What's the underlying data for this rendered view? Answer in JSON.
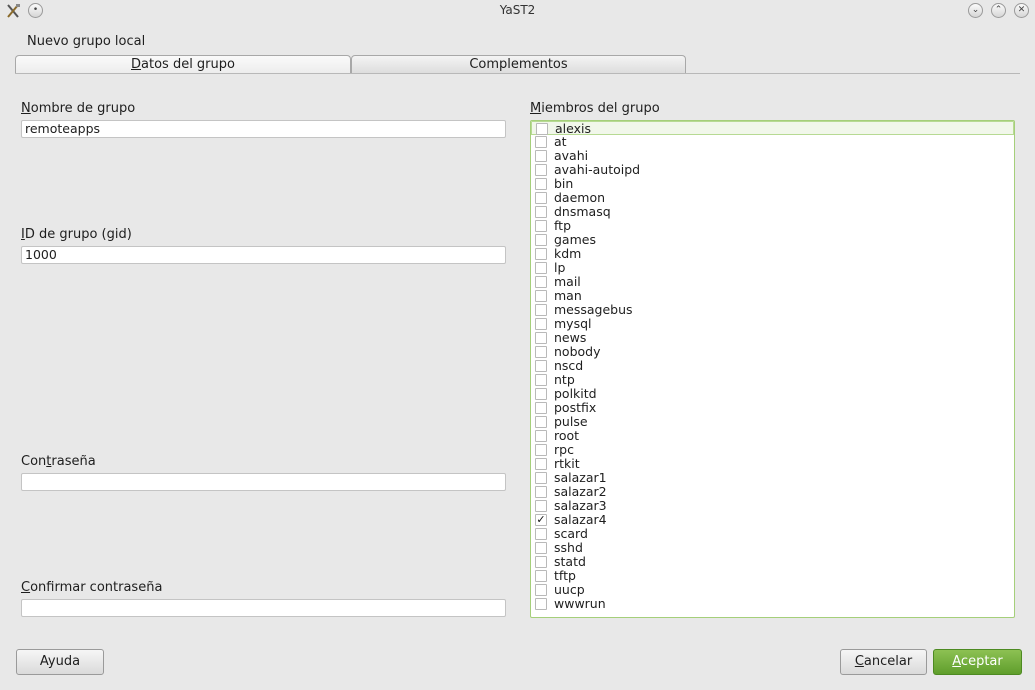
{
  "window": {
    "title": "YaST2",
    "controls": [
      "minimize-icon",
      "maximize-icon",
      "close-icon"
    ]
  },
  "dialog": {
    "heading": "Nuevo grupo local"
  },
  "tabs": [
    {
      "label_first": "D",
      "label_rest": "atos del grupo",
      "active": true
    },
    {
      "label": "Complementos",
      "active": false
    }
  ],
  "form": {
    "group_name": {
      "label_first": "N",
      "label_rest": "ombre de grupo",
      "value": "remoteapps"
    },
    "group_id": {
      "label_first": "I",
      "label_rest": "D de grupo (gid)",
      "value": "1000"
    },
    "password": {
      "label_pre": "Con",
      "label_ul": "t",
      "label_rest": "raseña",
      "value": ""
    },
    "confirm_password": {
      "label_first": "C",
      "label_rest": "onfirmar contraseña",
      "value": ""
    }
  },
  "members": {
    "label_first": "M",
    "label_rest": "iembros del grupo",
    "items": [
      {
        "name": "alexis",
        "checked": false
      },
      {
        "name": "at",
        "checked": false
      },
      {
        "name": "avahi",
        "checked": false
      },
      {
        "name": "avahi-autoipd",
        "checked": false
      },
      {
        "name": "bin",
        "checked": false
      },
      {
        "name": "daemon",
        "checked": false
      },
      {
        "name": "dnsmasq",
        "checked": false
      },
      {
        "name": "ftp",
        "checked": false
      },
      {
        "name": "games",
        "checked": false
      },
      {
        "name": "kdm",
        "checked": false
      },
      {
        "name": "lp",
        "checked": false
      },
      {
        "name": "mail",
        "checked": false
      },
      {
        "name": "man",
        "checked": false
      },
      {
        "name": "messagebus",
        "checked": false
      },
      {
        "name": "mysql",
        "checked": false
      },
      {
        "name": "news",
        "checked": false
      },
      {
        "name": "nobody",
        "checked": false
      },
      {
        "name": "nscd",
        "checked": false
      },
      {
        "name": "ntp",
        "checked": false
      },
      {
        "name": "polkitd",
        "checked": false
      },
      {
        "name": "postfix",
        "checked": false
      },
      {
        "name": "pulse",
        "checked": false
      },
      {
        "name": "root",
        "checked": false
      },
      {
        "name": "rpc",
        "checked": false
      },
      {
        "name": "rtkit",
        "checked": false
      },
      {
        "name": "salazar1",
        "checked": false
      },
      {
        "name": "salazar2",
        "checked": false
      },
      {
        "name": "salazar3",
        "checked": false
      },
      {
        "name": "salazar4",
        "checked": true
      },
      {
        "name": "scard",
        "checked": false
      },
      {
        "name": "sshd",
        "checked": false
      },
      {
        "name": "statd",
        "checked": false
      },
      {
        "name": "tftp",
        "checked": false
      },
      {
        "name": "uucp",
        "checked": false
      },
      {
        "name": "wwwrun",
        "checked": false
      }
    ]
  },
  "buttons": {
    "help": "Ayuda",
    "cancel_first": "C",
    "cancel_rest": "ancelar",
    "accept_first": "A",
    "accept_rest": "ceptar"
  },
  "colors": {
    "accent": "#6aa83a",
    "list_border": "#a5cf7a"
  }
}
